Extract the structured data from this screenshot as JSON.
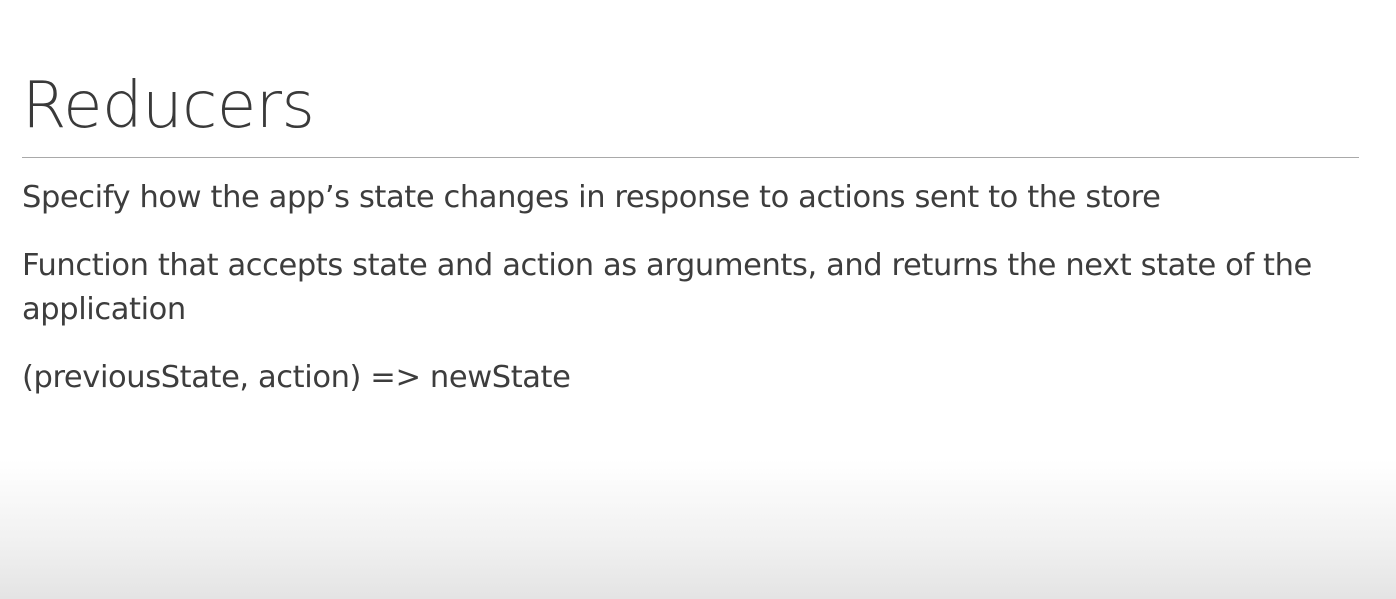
{
  "slide": {
    "title": "Reducers",
    "bullets": [
      "Specify how the app’s state changes in response to actions sent to the store",
      "Function that accepts state and action as arguments, and returns the next state of the application",
      "(previousState, action) => newState"
    ]
  }
}
